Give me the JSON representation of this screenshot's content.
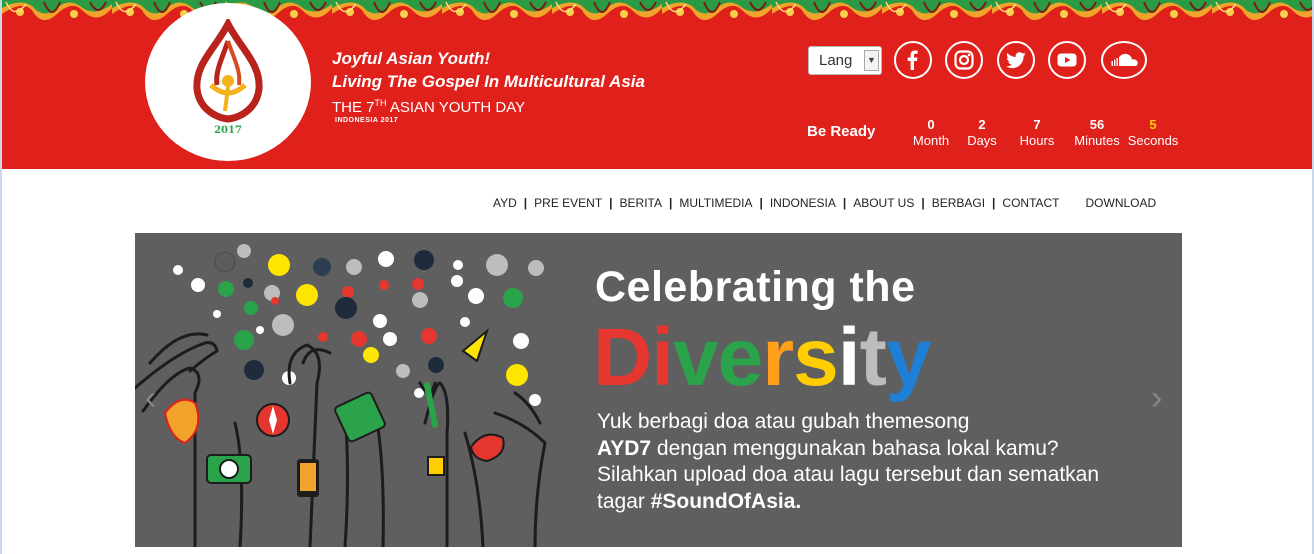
{
  "header": {
    "tagline_line1": "Joyful Asian Youth!",
    "tagline_line2": "Living The Gospel In Multicultural Asia",
    "title_prefix": "THE 7",
    "title_sup": "TH",
    "title_suffix": " ASIAN YOUTH DAY",
    "subtitle": "INDONESIA 2017",
    "logo_year": "2017",
    "lang_label": "Lang",
    "social_icons": [
      "facebook-icon",
      "instagram-icon",
      "twitter-icon",
      "youtube-icon",
      "soundcloud-icon"
    ]
  },
  "countdown": {
    "label": "Be Ready",
    "items": [
      {
        "value": "0",
        "unit": "Month"
      },
      {
        "value": "2",
        "unit": "Days"
      },
      {
        "value": "7",
        "unit": "Hours"
      },
      {
        "value": "56",
        "unit": "Minutes"
      },
      {
        "value": "5",
        "unit": "Seconds"
      }
    ]
  },
  "nav": {
    "items": [
      "AYD",
      "PRE EVENT",
      "BERITA",
      "MULTIMEDIA",
      "INDONESIA",
      "ABOUT US",
      "BERBAGI",
      "CONTACT",
      "DOWNLOAD"
    ]
  },
  "banner": {
    "headline": "Celebrating the",
    "diversity": [
      "D",
      "i",
      "v",
      "e",
      "r",
      "s",
      "i",
      "t",
      "y"
    ],
    "diversity_colors": [
      "#e53630",
      "#e53630",
      "#2aa34a",
      "#2aa34a",
      "#ff9f1c",
      "#ffcd00",
      "#ffffff",
      "#bdbdbd",
      "#1e7fd6"
    ],
    "line1": "Yuk berbagi doa atau gubah themesong",
    "line2_bold": "AYD7",
    "line2_rest": " dengan menggunakan bahasa lokal kamu?",
    "line3": "Silahkan upload doa atau lagu tersebut dan sematkan",
    "line4_prefix": "tagar ",
    "line4_bold": "#SoundOfAsia.",
    "prev_arrow": "‹",
    "next_arrow": "›"
  },
  "colors": {
    "header_red": "#e0201b",
    "banner_gray": "#5f5f60",
    "countdown_seconds": "#ffcd00"
  }
}
